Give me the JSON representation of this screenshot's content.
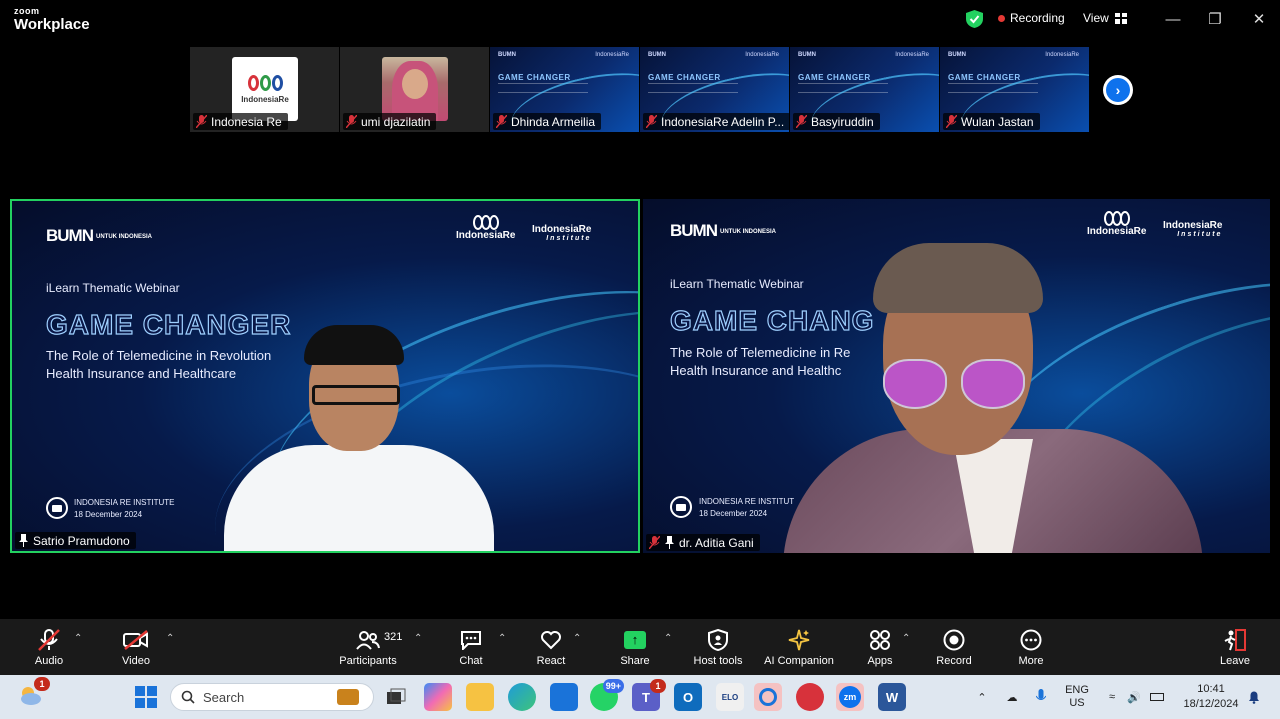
{
  "app": {
    "brand_small": "zoom",
    "brand_big": "Workplace"
  },
  "header": {
    "recording": "Recording",
    "view": "View"
  },
  "thumbnails": [
    {
      "name": "Indonesia Re",
      "kind": "logo",
      "logo_text": "IndonesiaRe"
    },
    {
      "name": "umi djazilatin",
      "kind": "photo"
    },
    {
      "name": "Dhinda Armeilia",
      "kind": "slide"
    },
    {
      "name": "IndonesiaRe Adelin P...",
      "kind": "slide"
    },
    {
      "name": "Basyiruddin",
      "kind": "slide"
    },
    {
      "name": "Wulan Jastan",
      "kind": "slide"
    }
  ],
  "slide": {
    "bumn": "BUMN",
    "bumn_small": "UNTUK INDONESIA",
    "ir_logo": "IndonesiaRe",
    "institute": "IndonesiaRe",
    "institute_small": "Institute",
    "kicker": "iLearn Thematic Webinar",
    "title": "GAME CHANGER",
    "sub1": "The Role of Telemedicine in Revolution",
    "sub2": "Health Insurance and Healthcare",
    "org1": "INDONESIA RE INSTITUTE",
    "org2": "18 December 2024",
    "right_title": "GAME CHANG",
    "right_sub1": "The Role of Telemedicine in Re",
    "right_sub2": "Health Insurance and Healthc",
    "right_org1": "INDONESIA RE INSTITUT"
  },
  "speakers": {
    "left": "Satrio Pramudono",
    "right": "dr. Aditia Gani"
  },
  "footer": {
    "audio": "Audio",
    "video": "Video",
    "participants": "Participants",
    "participant_count": "321",
    "chat": "Chat",
    "react": "React",
    "share": "Share",
    "host_tools": "Host tools",
    "ai_companion": "AI Companion",
    "apps": "Apps",
    "record": "Record",
    "more": "More",
    "leave": "Leave"
  },
  "taskbar": {
    "search": "Search",
    "weather_badge": "1",
    "whatsapp_badge": "99+",
    "teams_badge": "1",
    "elo": "ELO",
    "zoom": "zm",
    "word": "W",
    "lang1": "ENG",
    "lang2": "US",
    "time": "10:41",
    "date": "18/12/2024"
  },
  "colors": {
    "active_speaker": "#23d160",
    "accent": "#0e72ed",
    "share": "#23d160"
  }
}
